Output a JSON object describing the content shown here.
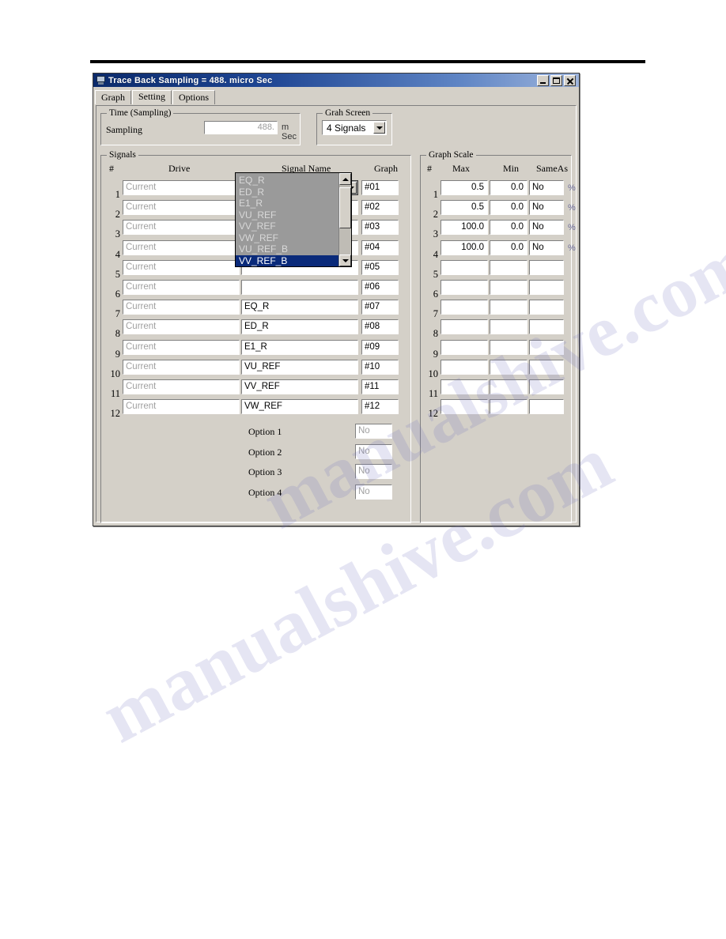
{
  "window": {
    "title": "Trace Back Sampling = 488. micro Sec",
    "icon": "monitor-icon",
    "buttons": {
      "minimize": "_",
      "maximize": "□",
      "close": "×"
    }
  },
  "tabs": [
    {
      "label": "Graph",
      "active": false
    },
    {
      "label": "Setting",
      "active": true
    },
    {
      "label": "Options",
      "active": false
    }
  ],
  "time_group": {
    "title": "Time (Sampling)",
    "sampling_label": "Sampling",
    "sampling_value": "488.",
    "unit": "m Sec"
  },
  "screen_group": {
    "title": "Grah Screen",
    "selected": "4 Signals"
  },
  "signals": {
    "title": "Signals",
    "headers": {
      "num": "#",
      "drive": "Drive",
      "signal": "Signal Name",
      "graph": "Graph"
    },
    "rows": [
      {
        "num": "1",
        "drive": "Current",
        "signal": "VV_REF_B",
        "graph": "#01"
      },
      {
        "num": "2",
        "drive": "Current",
        "signal": "",
        "graph": "#02"
      },
      {
        "num": "3",
        "drive": "Current",
        "signal": "",
        "graph": "#03"
      },
      {
        "num": "4",
        "drive": "Current",
        "signal": "",
        "graph": "#04"
      },
      {
        "num": "5",
        "drive": "Current",
        "signal": "",
        "graph": "#05"
      },
      {
        "num": "6",
        "drive": "Current",
        "signal": "",
        "graph": "#06"
      },
      {
        "num": "7",
        "drive": "Current",
        "signal": "EQ_R",
        "graph": "#07"
      },
      {
        "num": "8",
        "drive": "Current",
        "signal": "ED_R",
        "graph": "#08"
      },
      {
        "num": "9",
        "drive": "Current",
        "signal": "E1_R",
        "graph": "#09"
      },
      {
        "num": "10",
        "drive": "Current",
        "signal": "VU_REF",
        "graph": "#10"
      },
      {
        "num": "11",
        "drive": "Current",
        "signal": "VV_REF",
        "graph": "#11"
      },
      {
        "num": "12",
        "drive": "Current",
        "signal": "VW_REF",
        "graph": "#12"
      }
    ],
    "dropdown": {
      "open": true,
      "selected": "VV_REF_B",
      "items": [
        {
          "label": "EQ_R",
          "selected": false
        },
        {
          "label": "ED_R",
          "selected": false
        },
        {
          "label": "E1_R",
          "selected": false
        },
        {
          "label": "VU_REF",
          "selected": false
        },
        {
          "label": "VV_REF",
          "selected": false
        },
        {
          "label": "VW_REF",
          "selected": false
        },
        {
          "label": "VU_REF_B",
          "selected": false
        },
        {
          "label": "VV_REF_B",
          "selected": true
        }
      ]
    }
  },
  "options": [
    {
      "label": "Option 1",
      "value": "No"
    },
    {
      "label": "Option 2",
      "value": "No"
    },
    {
      "label": "Option 3",
      "value": "No"
    },
    {
      "label": "Option 4",
      "value": "No"
    }
  ],
  "graph_scale": {
    "title": "Graph Scale",
    "headers": {
      "num": "#",
      "max": "Max",
      "min": "Min",
      "sameas": "SameAs"
    },
    "unit": "%",
    "rows": [
      {
        "num": "1",
        "max": "0.5",
        "min": "0.0",
        "sameas": "No",
        "unit": "%"
      },
      {
        "num": "2",
        "max": "0.5",
        "min": "0.0",
        "sameas": "No",
        "unit": "%"
      },
      {
        "num": "3",
        "max": "100.0",
        "min": "0.0",
        "sameas": "No",
        "unit": "%"
      },
      {
        "num": "4",
        "max": "100.0",
        "min": "0.0",
        "sameas": "No",
        "unit": "%"
      },
      {
        "num": "5",
        "max": "",
        "min": "",
        "sameas": "",
        "unit": ""
      },
      {
        "num": "6",
        "max": "",
        "min": "",
        "sameas": "",
        "unit": ""
      },
      {
        "num": "7",
        "max": "",
        "min": "",
        "sameas": "",
        "unit": ""
      },
      {
        "num": "8",
        "max": "",
        "min": "",
        "sameas": "",
        "unit": ""
      },
      {
        "num": "9",
        "max": "",
        "min": "",
        "sameas": "",
        "unit": ""
      },
      {
        "num": "10",
        "max": "",
        "min": "",
        "sameas": "",
        "unit": ""
      },
      {
        "num": "11",
        "max": "",
        "min": "",
        "sameas": "",
        "unit": ""
      },
      {
        "num": "12",
        "max": "",
        "min": "",
        "sameas": "",
        "unit": ""
      }
    ]
  },
  "watermark": {
    "line1": "manualshive.com",
    "line2": "manualshive.com"
  },
  "colors": {
    "titlebar_start": "#0b2a6b",
    "titlebar_end": "#9db4dc",
    "face": "#d4d0c8",
    "selection": "#000080",
    "dropdown_bg": "#9a9a9a"
  }
}
